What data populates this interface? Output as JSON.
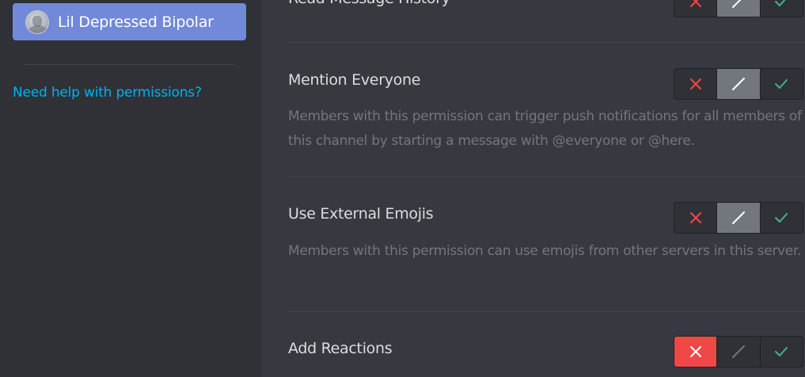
{
  "sidebar": {
    "role": {
      "name": "Lil Depressed Bipolar",
      "avatar_icon": "role-avatar-icon"
    },
    "help_link": "Need help with permissions?"
  },
  "colors": {
    "accent": "#7289da",
    "link": "#00b0f4",
    "deny": "#f04747",
    "allow": "#43b581",
    "neutral": "#72767d"
  },
  "permissions": [
    {
      "title": "Read Message History",
      "description": "",
      "state": "neutral"
    },
    {
      "title": "Mention Everyone",
      "description": "Members with this permission can trigger push notifications for all members of this channel by starting a message with @everyone or @here.",
      "state": "neutral"
    },
    {
      "title": "Use External Emojis",
      "description": "Members with this permission can use emojis from other servers in this server.",
      "state": "neutral"
    },
    {
      "title": "Add Reactions",
      "description": "",
      "state": "deny"
    }
  ],
  "toggle_icons": {
    "deny": "x-icon",
    "neutral": "slash-icon",
    "allow": "check-icon"
  }
}
